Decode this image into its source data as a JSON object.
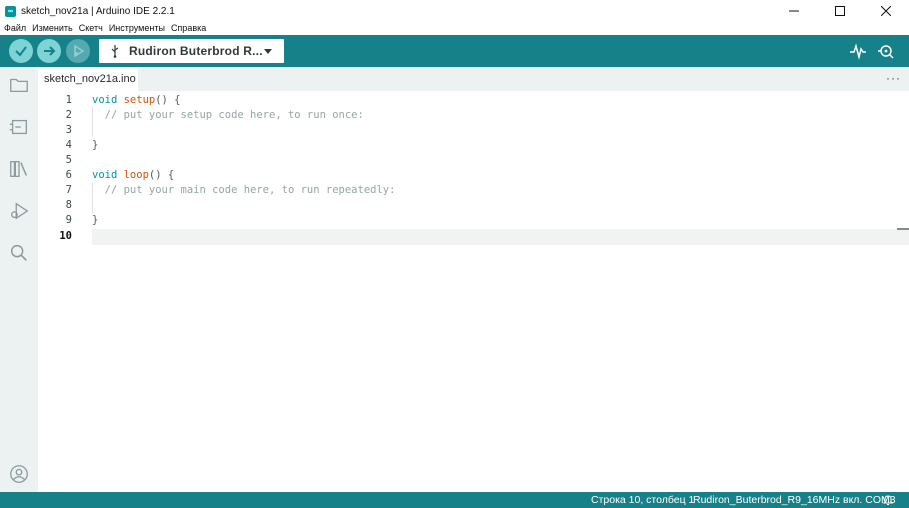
{
  "window": {
    "title": "sketch_nov21a | Arduino IDE 2.2.1",
    "app_icon": "arduino-logo-icon"
  },
  "menu": [
    "Файл",
    "Изменить",
    "Скетч",
    "Инструменты",
    "Справка"
  ],
  "toolbar": {
    "buttons": [
      "verify-icon",
      "upload-icon",
      "debug-icon"
    ],
    "board_label": "Rudiron Buterbrod R...",
    "right_icons": [
      "serial-plotter-icon",
      "serial-monitor-icon"
    ],
    "accent_color": "#17818a"
  },
  "sidebar": {
    "items": [
      "folder-icon",
      "boards-manager-icon",
      "library-icon",
      "debug-sidebar-icon",
      "search-icon"
    ],
    "bottom": "account-icon"
  },
  "editor": {
    "tab_label": "sketch_nov21a.ino",
    "more_label": "···",
    "line_numbers": [
      "1",
      "2",
      "3",
      "4",
      "5",
      "6",
      "7",
      "8",
      "9",
      "10"
    ],
    "active_line": "10",
    "lines": [
      {
        "kw": "void ",
        "fn": "setup",
        "rest": "() {"
      },
      {
        "comment": "  // put your setup code here, to run once:"
      },
      {
        "text": ""
      },
      {
        "text": "}"
      },
      {
        "text": ""
      },
      {
        "kw": "void ",
        "fn": "loop",
        "rest": "() {"
      },
      {
        "comment": "  // put your main code here, to run repeatedly:"
      },
      {
        "text": ""
      },
      {
        "text": "}"
      },
      {
        "text": ""
      }
    ]
  },
  "statusbar": {
    "position": "Строка 10, столбец 1",
    "board_port": "Rudiron_Buterbrod_R9_16MHz вкл. COM3",
    "bell": "bell-icon"
  }
}
